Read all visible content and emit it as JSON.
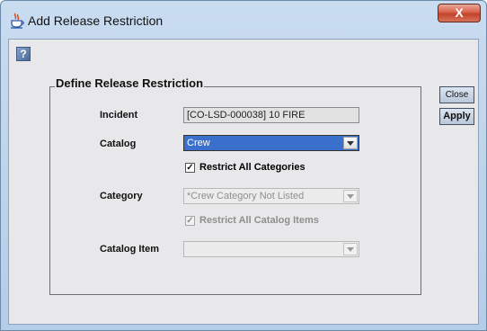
{
  "window": {
    "title": "Add Release Restriction",
    "app_icon": "java-cup-icon",
    "close_label": "X"
  },
  "help": {
    "icon": "help-icon",
    "label": "?"
  },
  "group": {
    "title": "Define Release Restriction"
  },
  "form": {
    "incident": {
      "label": "Incident",
      "value": "[CO-LSD-000038] 10 FIRE"
    },
    "catalog": {
      "label": "Catalog",
      "value": "Crew"
    },
    "restrict_all_categories": {
      "label": "Restrict All Categories",
      "checked": true,
      "enabled": true
    },
    "category": {
      "label": "Category",
      "value": "*Crew Category Not Listed",
      "enabled": false
    },
    "restrict_all_catalog_items": {
      "label": "Restrict All Catalog Items",
      "checked": true,
      "enabled": false
    },
    "catalog_item": {
      "label": "Catalog Item",
      "value": "",
      "enabled": false
    }
  },
  "buttons": {
    "close": "Close",
    "apply": "Apply"
  },
  "checkmark": "✓",
  "colors": {
    "selection": "#3a6fcc",
    "close_button": "#c9442b",
    "client_bg": "#e8e8ea"
  }
}
